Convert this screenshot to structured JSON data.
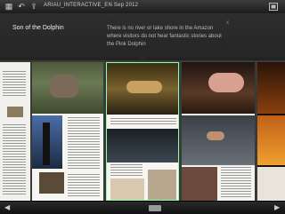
{
  "topbar": {
    "back_icon": "back-arrow-icon",
    "share_icon": "share-icon",
    "title": "ARIAU_INTERACTIVE_EN  Sep 2012",
    "zoom_icon": "zoom-icon"
  },
  "info": {
    "title": "Son of the Dolphin",
    "description": "There is no river or lake shore in the Amazon where visitors do not hear fantastic stories about the Pink Dolphin",
    "close_label": "x"
  },
  "bottombar": {
    "prev_icon": "left-arrow-icon",
    "next_icon": "right-arrow-icon",
    "pager_label": "·"
  },
  "colors": {
    "accent": "#8fa",
    "background": "#222222"
  }
}
